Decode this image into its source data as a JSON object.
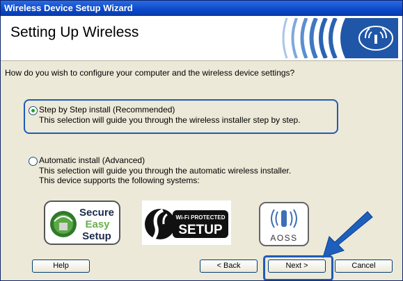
{
  "window": {
    "title": "Wireless Device Setup Wizard"
  },
  "header": {
    "title": "Setting Up Wireless",
    "icon": "wireless-waves-icon"
  },
  "question": "How do you wish to configure your computer and the wireless device settings?",
  "options": [
    {
      "label": "Step by Step install (Recommended)",
      "description": "This selection will guide you through the wireless installer step by step.",
      "selected": true
    },
    {
      "label": "Automatic install (Advanced)",
      "description_lines": [
        "This selection will guide you through the automatic wireless installer.",
        "This device supports the following systems:"
      ],
      "selected": false
    }
  ],
  "systems": [
    {
      "name": "Secure Easy Setup",
      "lines": [
        "Secure",
        "Easy",
        "Setup"
      ]
    },
    {
      "name": "Wi-Fi Protected Setup",
      "lines": [
        "Wi-Fi PROTECTED",
        "SETUP"
      ]
    },
    {
      "name": "AOSS",
      "lines": [
        "AOSS"
      ]
    }
  ],
  "buttons": {
    "help": "Help",
    "back": "< Back",
    "next": "Next >",
    "cancel": "Cancel"
  },
  "colors": {
    "highlight": "#1f5ab8",
    "titlebar": "#0a48c8"
  }
}
